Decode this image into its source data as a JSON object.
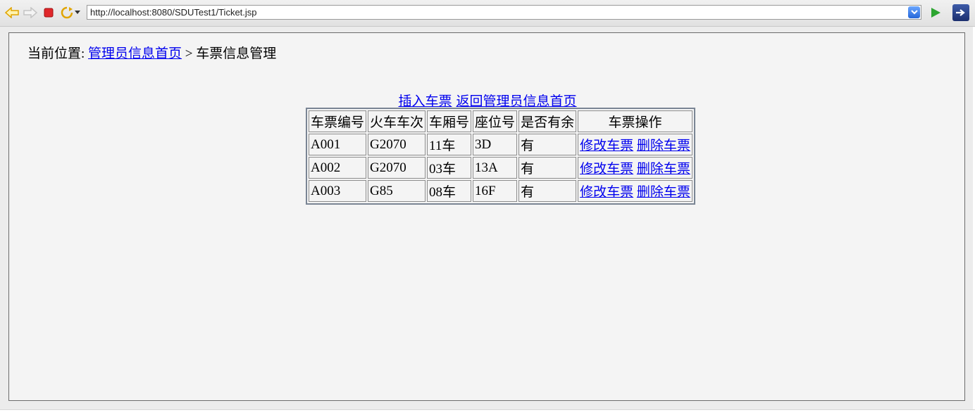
{
  "browser": {
    "url": "http://localhost:8080/SDUTest1/Ticket.jsp",
    "colors": {
      "go": "#2da531",
      "stop": "#e0272b",
      "nav_arrow": "#f0b400"
    }
  },
  "breadcrumb": {
    "prefix": "当前位置: ",
    "link": "管理员信息首页",
    "separator": " > ",
    "current": "车票信息管理"
  },
  "actions": {
    "insert": "插入车票",
    "back_home": "返回管理员信息首页"
  },
  "table": {
    "headers": [
      "车票编号",
      "火车车次",
      "车厢号",
      "座位号",
      "是否有余",
      "车票操作"
    ],
    "rows": [
      {
        "id": "A001",
        "train": "G2070",
        "carriage": "11车",
        "seat": "3D",
        "available": "有",
        "edit": "修改车票",
        "delete": "删除车票"
      },
      {
        "id": "A002",
        "train": "G2070",
        "carriage": "03车",
        "seat": "13A",
        "available": "有",
        "edit": "修改车票",
        "delete": "删除车票"
      },
      {
        "id": "A003",
        "train": "G85",
        "carriage": "08车",
        "seat": "16F",
        "available": "有",
        "edit": "修改车票",
        "delete": "删除车票"
      }
    ]
  }
}
